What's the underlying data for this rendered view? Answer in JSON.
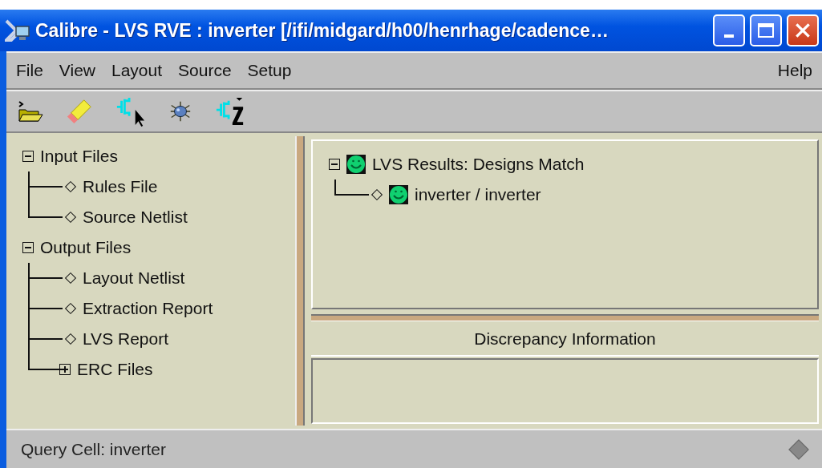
{
  "window": {
    "title": "Calibre - LVS RVE : inverter [/ifi/midgard/h00/henrhage/cadence…"
  },
  "menu": {
    "left": [
      "File",
      "View",
      "Layout",
      "Source",
      "Setup"
    ],
    "right": [
      "Help"
    ]
  },
  "file_tree": [
    {
      "label": "Input Files",
      "kind": "folder",
      "expanded": true,
      "children": [
        {
          "label": "Rules File",
          "kind": "leaf"
        },
        {
          "label": "Source Netlist",
          "kind": "leaf"
        }
      ]
    },
    {
      "label": "Output Files",
      "kind": "folder",
      "expanded": true,
      "children": [
        {
          "label": "Layout Netlist",
          "kind": "leaf"
        },
        {
          "label": "Extraction Report",
          "kind": "leaf"
        },
        {
          "label": "LVS Report",
          "kind": "leaf"
        },
        {
          "label": "ERC Files",
          "kind": "folder",
          "expanded": false
        }
      ]
    }
  ],
  "results_tree": [
    {
      "label": "LVS Results: Designs Match",
      "kind": "folder",
      "expanded": true,
      "children": [
        {
          "label": "inverter / inverter",
          "kind": "leaf"
        }
      ]
    }
  ],
  "discrepancy": {
    "title": "Discrepancy Information"
  },
  "status_bar": {
    "text": "Query Cell: inverter"
  }
}
